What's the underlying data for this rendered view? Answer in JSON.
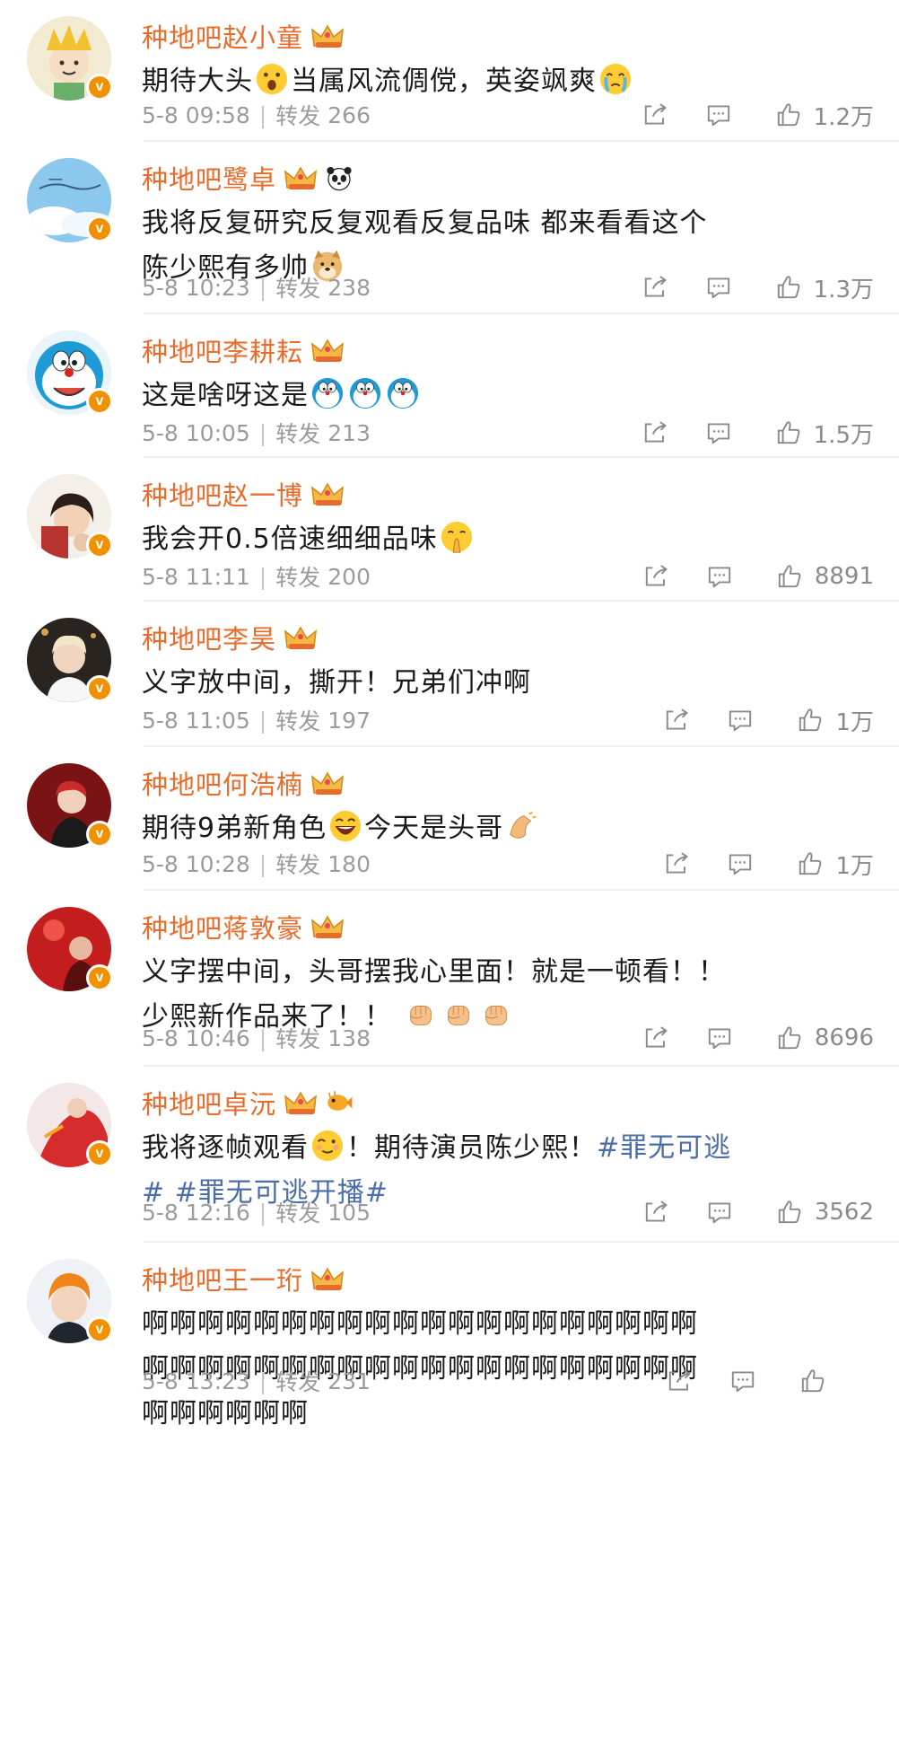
{
  "comments": [
    {
      "username": "种地吧赵小童",
      "text_parts": [
        {
          "t": "期待大头"
        },
        {
          "emoji": "gasp"
        },
        {
          "t": "当属风流倜傥，英姿飒爽"
        },
        {
          "emoji": "tears"
        }
      ],
      "date": "5-8 09:58",
      "repost_label": "转发",
      "repost_count": "266",
      "likes": "1.2万",
      "avatar": "prince"
    },
    {
      "username": "种地吧鹭卓",
      "extra_icon": "panda-icon",
      "text_parts": [
        {
          "t": "我将反复研究反复观看反复品味 都来看看这个陈少熙有多帅"
        },
        {
          "emoji": "doge"
        }
      ],
      "date": "5-8 10:23",
      "repost_label": "转发",
      "repost_count": "238",
      "likes": "1.3万",
      "avatar": "sky"
    },
    {
      "username": "种地吧李耕耘",
      "text_parts": [
        {
          "t": "这是啥呀这是"
        },
        {
          "emoji": "doraemon"
        },
        {
          "emoji": "doraemon"
        },
        {
          "emoji": "doraemon"
        }
      ],
      "date": "5-8 10:05",
      "repost_label": "转发",
      "repost_count": "213",
      "likes": "1.5万",
      "avatar": "doraemon"
    },
    {
      "username": "种地吧赵一博",
      "text_parts": [
        {
          "t": "我会开0.5倍速细细品味"
        },
        {
          "emoji": "pray"
        }
      ],
      "date": "5-8 11:11",
      "repost_label": "转发",
      "repost_count": "200",
      "likes": "8891",
      "avatar": "girl"
    },
    {
      "username": "种地吧李昊",
      "text_parts": [
        {
          "t": "义字放中间，撕开！兄弟们冲啊"
        }
      ],
      "date": "5-8 11:05",
      "repost_label": "转发",
      "repost_count": "197",
      "likes": "1万",
      "avatar": "boy-dark"
    },
    {
      "username": "种地吧何浩楠",
      "text_parts": [
        {
          "t": "期待9弟新角色"
        },
        {
          "emoji": "laugh"
        },
        {
          "t": "今天是头哥"
        },
        {
          "emoji": "clap"
        }
      ],
      "date": "5-8 10:28",
      "repost_label": "转发",
      "repost_count": "180",
      "likes": "1万",
      "avatar": "boy-red"
    },
    {
      "username": "种地吧蒋敦豪",
      "text_parts": [
        {
          "t": "义字摆中间，头哥摆我心里面！就是一顿看！！ 少熙新作品来了！！ "
        },
        {
          "emoji": "fist"
        },
        {
          "emoji": "fist"
        },
        {
          "emoji": "fist"
        }
      ],
      "date": "5-8 10:46",
      "repost_label": "转发",
      "repost_count": "138",
      "likes": "8696",
      "avatar": "stage"
    },
    {
      "username": "种地吧卓沅",
      "extra_icon": "fish-icon",
      "text_parts": [
        {
          "t": "我将逐帧观看"
        },
        {
          "emoji": "cute"
        },
        {
          "t": "！期待演员陈少熙！"
        },
        {
          "hashtag": "#罪无可逃# #罪无可逃开播#"
        }
      ],
      "date": "5-8 12:16",
      "repost_label": "转发",
      "repost_count": "105",
      "likes": "3562",
      "avatar": "red-stage"
    },
    {
      "username": "种地吧王一珩",
      "text_parts": [
        {
          "t": "啊啊啊啊啊啊啊啊啊啊啊啊啊啊啊啊啊啊啊啊啊啊啊啊啊啊啊啊啊啊啊啊啊啊啊啊啊啊啊啊啊啊啊啊啊啊"
        }
      ],
      "date": "5-8 13:23",
      "repost_label": "转发",
      "repost_count": "231",
      "likes": "",
      "avatar": "orange-hair"
    }
  ]
}
